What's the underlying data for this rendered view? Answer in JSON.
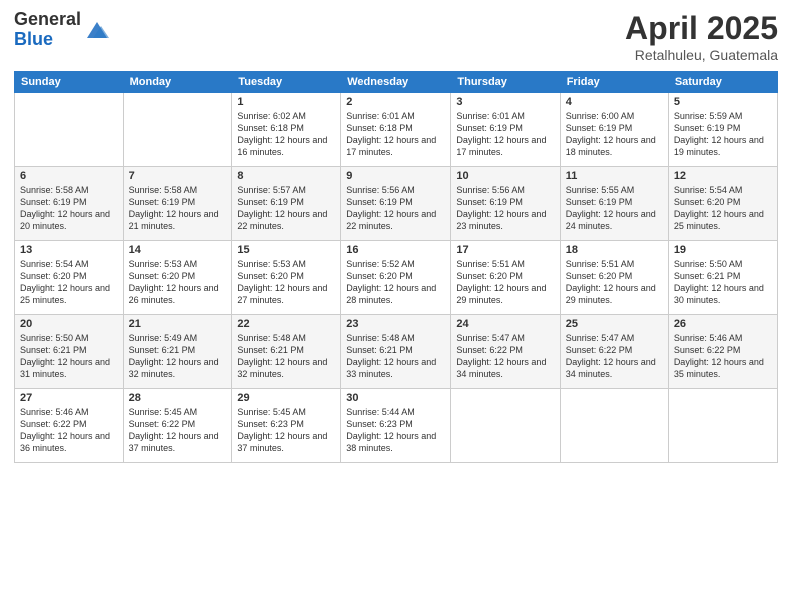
{
  "logo": {
    "general": "General",
    "blue": "Blue"
  },
  "title": {
    "month": "April 2025",
    "location": "Retalhuleu, Guatemala"
  },
  "weekdays": [
    "Sunday",
    "Monday",
    "Tuesday",
    "Wednesday",
    "Thursday",
    "Friday",
    "Saturday"
  ],
  "weeks": [
    [
      {
        "day": "",
        "sunrise": "",
        "sunset": "",
        "daylight": ""
      },
      {
        "day": "",
        "sunrise": "",
        "sunset": "",
        "daylight": ""
      },
      {
        "day": "1",
        "sunrise": "Sunrise: 6:02 AM",
        "sunset": "Sunset: 6:18 PM",
        "daylight": "Daylight: 12 hours and 16 minutes."
      },
      {
        "day": "2",
        "sunrise": "Sunrise: 6:01 AM",
        "sunset": "Sunset: 6:18 PM",
        "daylight": "Daylight: 12 hours and 17 minutes."
      },
      {
        "day": "3",
        "sunrise": "Sunrise: 6:01 AM",
        "sunset": "Sunset: 6:19 PM",
        "daylight": "Daylight: 12 hours and 17 minutes."
      },
      {
        "day": "4",
        "sunrise": "Sunrise: 6:00 AM",
        "sunset": "Sunset: 6:19 PM",
        "daylight": "Daylight: 12 hours and 18 minutes."
      },
      {
        "day": "5",
        "sunrise": "Sunrise: 5:59 AM",
        "sunset": "Sunset: 6:19 PM",
        "daylight": "Daylight: 12 hours and 19 minutes."
      }
    ],
    [
      {
        "day": "6",
        "sunrise": "Sunrise: 5:58 AM",
        "sunset": "Sunset: 6:19 PM",
        "daylight": "Daylight: 12 hours and 20 minutes."
      },
      {
        "day": "7",
        "sunrise": "Sunrise: 5:58 AM",
        "sunset": "Sunset: 6:19 PM",
        "daylight": "Daylight: 12 hours and 21 minutes."
      },
      {
        "day": "8",
        "sunrise": "Sunrise: 5:57 AM",
        "sunset": "Sunset: 6:19 PM",
        "daylight": "Daylight: 12 hours and 22 minutes."
      },
      {
        "day": "9",
        "sunrise": "Sunrise: 5:56 AM",
        "sunset": "Sunset: 6:19 PM",
        "daylight": "Daylight: 12 hours and 22 minutes."
      },
      {
        "day": "10",
        "sunrise": "Sunrise: 5:56 AM",
        "sunset": "Sunset: 6:19 PM",
        "daylight": "Daylight: 12 hours and 23 minutes."
      },
      {
        "day": "11",
        "sunrise": "Sunrise: 5:55 AM",
        "sunset": "Sunset: 6:19 PM",
        "daylight": "Daylight: 12 hours and 24 minutes."
      },
      {
        "day": "12",
        "sunrise": "Sunrise: 5:54 AM",
        "sunset": "Sunset: 6:20 PM",
        "daylight": "Daylight: 12 hours and 25 minutes."
      }
    ],
    [
      {
        "day": "13",
        "sunrise": "Sunrise: 5:54 AM",
        "sunset": "Sunset: 6:20 PM",
        "daylight": "Daylight: 12 hours and 25 minutes."
      },
      {
        "day": "14",
        "sunrise": "Sunrise: 5:53 AM",
        "sunset": "Sunset: 6:20 PM",
        "daylight": "Daylight: 12 hours and 26 minutes."
      },
      {
        "day": "15",
        "sunrise": "Sunrise: 5:53 AM",
        "sunset": "Sunset: 6:20 PM",
        "daylight": "Daylight: 12 hours and 27 minutes."
      },
      {
        "day": "16",
        "sunrise": "Sunrise: 5:52 AM",
        "sunset": "Sunset: 6:20 PM",
        "daylight": "Daylight: 12 hours and 28 minutes."
      },
      {
        "day": "17",
        "sunrise": "Sunrise: 5:51 AM",
        "sunset": "Sunset: 6:20 PM",
        "daylight": "Daylight: 12 hours and 29 minutes."
      },
      {
        "day": "18",
        "sunrise": "Sunrise: 5:51 AM",
        "sunset": "Sunset: 6:20 PM",
        "daylight": "Daylight: 12 hours and 29 minutes."
      },
      {
        "day": "19",
        "sunrise": "Sunrise: 5:50 AM",
        "sunset": "Sunset: 6:21 PM",
        "daylight": "Daylight: 12 hours and 30 minutes."
      }
    ],
    [
      {
        "day": "20",
        "sunrise": "Sunrise: 5:50 AM",
        "sunset": "Sunset: 6:21 PM",
        "daylight": "Daylight: 12 hours and 31 minutes."
      },
      {
        "day": "21",
        "sunrise": "Sunrise: 5:49 AM",
        "sunset": "Sunset: 6:21 PM",
        "daylight": "Daylight: 12 hours and 32 minutes."
      },
      {
        "day": "22",
        "sunrise": "Sunrise: 5:48 AM",
        "sunset": "Sunset: 6:21 PM",
        "daylight": "Daylight: 12 hours and 32 minutes."
      },
      {
        "day": "23",
        "sunrise": "Sunrise: 5:48 AM",
        "sunset": "Sunset: 6:21 PM",
        "daylight": "Daylight: 12 hours and 33 minutes."
      },
      {
        "day": "24",
        "sunrise": "Sunrise: 5:47 AM",
        "sunset": "Sunset: 6:22 PM",
        "daylight": "Daylight: 12 hours and 34 minutes."
      },
      {
        "day": "25",
        "sunrise": "Sunrise: 5:47 AM",
        "sunset": "Sunset: 6:22 PM",
        "daylight": "Daylight: 12 hours and 34 minutes."
      },
      {
        "day": "26",
        "sunrise": "Sunrise: 5:46 AM",
        "sunset": "Sunset: 6:22 PM",
        "daylight": "Daylight: 12 hours and 35 minutes."
      }
    ],
    [
      {
        "day": "27",
        "sunrise": "Sunrise: 5:46 AM",
        "sunset": "Sunset: 6:22 PM",
        "daylight": "Daylight: 12 hours and 36 minutes."
      },
      {
        "day": "28",
        "sunrise": "Sunrise: 5:45 AM",
        "sunset": "Sunset: 6:22 PM",
        "daylight": "Daylight: 12 hours and 37 minutes."
      },
      {
        "day": "29",
        "sunrise": "Sunrise: 5:45 AM",
        "sunset": "Sunset: 6:23 PM",
        "daylight": "Daylight: 12 hours and 37 minutes."
      },
      {
        "day": "30",
        "sunrise": "Sunrise: 5:44 AM",
        "sunset": "Sunset: 6:23 PM",
        "daylight": "Daylight: 12 hours and 38 minutes."
      },
      {
        "day": "",
        "sunrise": "",
        "sunset": "",
        "daylight": ""
      },
      {
        "day": "",
        "sunrise": "",
        "sunset": "",
        "daylight": ""
      },
      {
        "day": "",
        "sunrise": "",
        "sunset": "",
        "daylight": ""
      }
    ]
  ]
}
